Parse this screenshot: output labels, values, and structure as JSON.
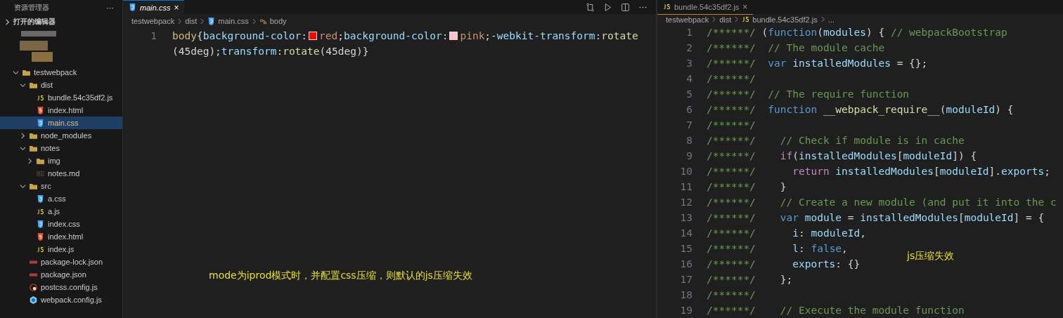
{
  "sidebar": {
    "title": "资源管理器",
    "more": "···",
    "open_editors": {
      "label": "打开的编辑器",
      "expanded": false
    },
    "tree": [
      {
        "name": "testwebpack",
        "kind": "folder",
        "expanded": true,
        "selected": false,
        "children": [
          {
            "name": "dist",
            "kind": "folder",
            "expanded": true,
            "selected": false,
            "children": [
              {
                "name": "bundle.54c35df2.js",
                "kind": "js",
                "selected": false
              },
              {
                "name": "index.html",
                "kind": "html",
                "selected": false
              },
              {
                "name": "main.css",
                "kind": "css",
                "selected": true
              }
            ]
          },
          {
            "name": "node_modules",
            "kind": "folder",
            "expanded": false,
            "selected": false
          },
          {
            "name": "notes",
            "kind": "folder",
            "expanded": true,
            "selected": false,
            "children": [
              {
                "name": "img",
                "kind": "folder",
                "expanded": false,
                "selected": false
              },
              {
                "name": "notes.md",
                "kind": "md",
                "selected": false
              }
            ]
          },
          {
            "name": "src",
            "kind": "folder",
            "expanded": true,
            "selected": false,
            "children": [
              {
                "name": "a.css",
                "kind": "css",
                "selected": false
              },
              {
                "name": "a.js",
                "kind": "js",
                "selected": false
              },
              {
                "name": "index.css",
                "kind": "css",
                "selected": false
              },
              {
                "name": "index.html",
                "kind": "html",
                "selected": false
              },
              {
                "name": "index.js",
                "kind": "js",
                "selected": false
              }
            ]
          },
          {
            "name": "package-lock.json",
            "kind": "json",
            "selected": false
          },
          {
            "name": "package.json",
            "kind": "json",
            "selected": false
          },
          {
            "name": "postcss.config.js",
            "kind": "postcss",
            "selected": false
          },
          {
            "name": "webpack.config.js",
            "kind": "webpack",
            "selected": false
          }
        ]
      }
    ]
  },
  "editors": [
    {
      "tab": {
        "label": "main.css",
        "kind": "css",
        "close": "×",
        "selected": true
      },
      "breadcrumb": [
        {
          "text": "testwebpack",
          "kind": "text"
        },
        {
          "text": "dist",
          "kind": "text"
        },
        {
          "text": "main.css",
          "kind": "css"
        },
        {
          "text": "body",
          "kind": "symbol"
        }
      ],
      "lines": [
        {
          "number": "1",
          "tokens": [
            {
              "t": "body",
              "kind": "selector"
            },
            {
              "t": "{",
              "kind": "punct"
            },
            {
              "t": "background-color",
              "kind": "prop"
            },
            {
              "t": ":",
              "kind": "punct"
            },
            {
              "kind": "swatch",
              "color": "#ff0000"
            },
            {
              "t": "red",
              "kind": "value"
            },
            {
              "t": ";",
              "kind": "punct"
            },
            {
              "t": "background-color",
              "kind": "prop"
            },
            {
              "t": ":",
              "kind": "punct"
            },
            {
              "kind": "swatch",
              "color": "#ffc0cb"
            },
            {
              "t": "pink",
              "kind": "value"
            },
            {
              "t": ";",
              "kind": "punct"
            },
            {
              "t": "-webkit-transform",
              "kind": "prop"
            },
            {
              "t": ":",
              "kind": "punct"
            },
            {
              "t": "rotate",
              "kind": "func"
            },
            {
              "t": "(45deg)",
              "kind": "punct"
            },
            {
              "t": ";",
              "kind": "punct"
            },
            {
              "t": "transform",
              "kind": "prop"
            },
            {
              "t": ":",
              "kind": "punct"
            },
            {
              "t": "rotate",
              "kind": "func"
            },
            {
              "t": "(45deg)}",
              "kind": "punct"
            }
          ]
        }
      ],
      "note": "mode为iprod模式时，并配置css压缩，则默认的js压缩失效"
    },
    {
      "tab": {
        "label": "bundle.54c35df2.js",
        "kind": "js",
        "close": "×",
        "selected": false
      },
      "breadcrumb": [
        {
          "text": "testwebpack",
          "kind": "text"
        },
        {
          "text": "dist",
          "kind": "text"
        },
        {
          "text": "bundle.54c35df2.js",
          "kind": "js"
        },
        {
          "text": "...",
          "kind": "text"
        }
      ],
      "lines": [
        {
          "number": "1",
          "tokens": [
            {
              "t": "/******/ ",
              "kind": "comment"
            },
            {
              "t": "(",
              "kind": "punct"
            },
            {
              "t": "function",
              "kind": "keyword"
            },
            {
              "t": "(",
              "kind": "punct"
            },
            {
              "t": "modules",
              "kind": "var"
            },
            {
              "t": ") { ",
              "kind": "punct"
            },
            {
              "t": "// webpackBootstrap",
              "kind": "comment"
            }
          ]
        },
        {
          "number": "2",
          "tokens": [
            {
              "t": "/******/ ",
              "kind": "comment"
            },
            {
              "t": " // The module cache",
              "kind": "comment"
            }
          ]
        },
        {
          "number": "3",
          "tokens": [
            {
              "t": "/******/ ",
              "kind": "comment"
            },
            {
              "t": " var ",
              "kind": "keyword"
            },
            {
              "t": "installedModules",
              "kind": "var"
            },
            {
              "t": " = {};",
              "kind": "punct"
            }
          ]
        },
        {
          "number": "4",
          "tokens": [
            {
              "t": "/******/",
              "kind": "comment"
            }
          ]
        },
        {
          "number": "5",
          "tokens": [
            {
              "t": "/******/ ",
              "kind": "comment"
            },
            {
              "t": " // The require function",
              "kind": "comment"
            }
          ]
        },
        {
          "number": "6",
          "tokens": [
            {
              "t": "/******/ ",
              "kind": "comment"
            },
            {
              "t": " function ",
              "kind": "keyword"
            },
            {
              "t": "__webpack_require__",
              "kind": "func"
            },
            {
              "t": "(",
              "kind": "punct"
            },
            {
              "t": "moduleId",
              "kind": "var"
            },
            {
              "t": ") {",
              "kind": "punct"
            }
          ]
        },
        {
          "number": "7",
          "tokens": [
            {
              "t": "/******/",
              "kind": "comment"
            }
          ]
        },
        {
          "number": "8",
          "tokens": [
            {
              "t": "/******/ ",
              "kind": "comment"
            },
            {
              "t": "   // Check if module is in cache",
              "kind": "comment"
            }
          ]
        },
        {
          "number": "9",
          "tokens": [
            {
              "t": "/******/ ",
              "kind": "comment"
            },
            {
              "t": "   if",
              "kind": "control"
            },
            {
              "t": "(",
              "kind": "punct"
            },
            {
              "t": "installedModules",
              "kind": "var"
            },
            {
              "t": "[",
              "kind": "punct"
            },
            {
              "t": "moduleId",
              "kind": "var"
            },
            {
              "t": "]) {",
              "kind": "punct"
            }
          ]
        },
        {
          "number": "10",
          "tokens": [
            {
              "t": "/******/ ",
              "kind": "comment"
            },
            {
              "t": "     return ",
              "kind": "control"
            },
            {
              "t": "installedModules",
              "kind": "var"
            },
            {
              "t": "[",
              "kind": "punct"
            },
            {
              "t": "moduleId",
              "kind": "var"
            },
            {
              "t": "].",
              "kind": "punct"
            },
            {
              "t": "exports",
              "kind": "var"
            },
            {
              "t": ";",
              "kind": "punct"
            }
          ]
        },
        {
          "number": "11",
          "tokens": [
            {
              "t": "/******/ ",
              "kind": "comment"
            },
            {
              "t": "   }",
              "kind": "punct"
            }
          ]
        },
        {
          "number": "12",
          "tokens": [
            {
              "t": "/******/ ",
              "kind": "comment"
            },
            {
              "t": "   // Create a new module (and put it into the c",
              "kind": "comment"
            }
          ]
        },
        {
          "number": "13",
          "tokens": [
            {
              "t": "/******/ ",
              "kind": "comment"
            },
            {
              "t": "   var ",
              "kind": "keyword"
            },
            {
              "t": "module",
              "kind": "var"
            },
            {
              "t": " = ",
              "kind": "punct"
            },
            {
              "t": "installedModules",
              "kind": "var"
            },
            {
              "t": "[",
              "kind": "punct"
            },
            {
              "t": "moduleId",
              "kind": "var"
            },
            {
              "t": "] = {",
              "kind": "punct"
            }
          ]
        },
        {
          "number": "14",
          "tokens": [
            {
              "t": "/******/ ",
              "kind": "comment"
            },
            {
              "t": "     i",
              "kind": "var"
            },
            {
              "t": ": ",
              "kind": "punct"
            },
            {
              "t": "moduleId",
              "kind": "var"
            },
            {
              "t": ",",
              "kind": "punct"
            }
          ]
        },
        {
          "number": "15",
          "tokens": [
            {
              "t": "/******/ ",
              "kind": "comment"
            },
            {
              "t": "     l",
              "kind": "var"
            },
            {
              "t": ": ",
              "kind": "punct"
            },
            {
              "t": "false",
              "kind": "keyword"
            },
            {
              "t": ",",
              "kind": "punct"
            }
          ]
        },
        {
          "number": "16",
          "tokens": [
            {
              "t": "/******/ ",
              "kind": "comment"
            },
            {
              "t": "     exports",
              "kind": "var"
            },
            {
              "t": ": {}",
              "kind": "punct"
            }
          ]
        },
        {
          "number": "17",
          "tokens": [
            {
              "t": "/******/ ",
              "kind": "comment"
            },
            {
              "t": "   };",
              "kind": "punct"
            }
          ]
        },
        {
          "number": "18",
          "tokens": [
            {
              "t": "/******/",
              "kind": "comment"
            }
          ]
        },
        {
          "number": "19",
          "tokens": [
            {
              "t": "/******/ ",
              "kind": "comment"
            },
            {
              "t": "   // Execute the module function",
              "kind": "comment"
            }
          ]
        }
      ],
      "note": "js压缩失效"
    }
  ]
}
